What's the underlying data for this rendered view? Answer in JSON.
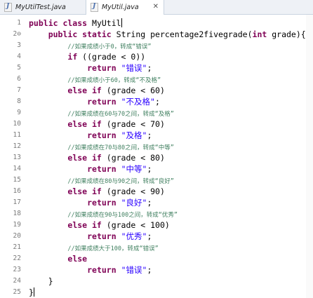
{
  "tabs": [
    {
      "label": "MyUtilTest.java",
      "active": false
    },
    {
      "label": "MyUtil.java",
      "active": true,
      "close": "✕"
    }
  ],
  "icons": {
    "java_file": "java-file-icon",
    "close": "close-icon",
    "fold": "fold-collapse-icon"
  },
  "colors": {
    "keyword": "#7f0055",
    "string": "#2a00ff",
    "comment": "#3f7f5f",
    "line_number": "#7b7b7b"
  },
  "editor": {
    "lines": [
      {
        "num": "1",
        "tokens": [
          {
            "t": "kw",
            "v": "public class"
          },
          {
            "t": "plain",
            "v": " MyUtil"
          },
          {
            "t": "cursor",
            "v": ""
          }
        ]
      },
      {
        "num": "2⊖",
        "tokens": [
          {
            "t": "plain",
            "v": "    "
          },
          {
            "t": "kw",
            "v": "public static"
          },
          {
            "t": "plain",
            "v": " String percentage2fivegrade("
          },
          {
            "t": "kw",
            "v": "int"
          },
          {
            "t": "plain",
            "v": " grade){"
          }
        ]
      },
      {
        "num": "3",
        "tokens": [
          {
            "t": "plain",
            "v": "        "
          },
          {
            "t": "cmt",
            "v": "//如果成绩小于0，转成“错误”"
          }
        ]
      },
      {
        "num": "4",
        "tokens": [
          {
            "t": "plain",
            "v": "        "
          },
          {
            "t": "kw",
            "v": "if"
          },
          {
            "t": "plain",
            "v": " ((grade < 0))"
          }
        ]
      },
      {
        "num": "5",
        "tokens": [
          {
            "t": "plain",
            "v": "            "
          },
          {
            "t": "kw",
            "v": "return"
          },
          {
            "t": "plain",
            "v": " "
          },
          {
            "t": "str",
            "v": "\"错误\""
          },
          {
            "t": "plain",
            "v": ";"
          }
        ]
      },
      {
        "num": "6",
        "tokens": [
          {
            "t": "plain",
            "v": "        "
          },
          {
            "t": "cmt",
            "v": "//如果成绩小于60，转成“不及格”"
          }
        ]
      },
      {
        "num": "7",
        "tokens": [
          {
            "t": "plain",
            "v": "        "
          },
          {
            "t": "kw",
            "v": "else if"
          },
          {
            "t": "plain",
            "v": " (grade < 60)"
          }
        ]
      },
      {
        "num": "8",
        "tokens": [
          {
            "t": "plain",
            "v": "            "
          },
          {
            "t": "kw",
            "v": "return"
          },
          {
            "t": "plain",
            "v": " "
          },
          {
            "t": "str",
            "v": "\"不及格\""
          },
          {
            "t": "plain",
            "v": ";"
          }
        ]
      },
      {
        "num": "9",
        "tokens": [
          {
            "t": "plain",
            "v": "        "
          },
          {
            "t": "cmt",
            "v": "//如果成绩在60与70之间，转成“及格”"
          }
        ]
      },
      {
        "num": "10",
        "tokens": [
          {
            "t": "plain",
            "v": "        "
          },
          {
            "t": "kw",
            "v": "else if"
          },
          {
            "t": "plain",
            "v": " (grade < 70)"
          }
        ]
      },
      {
        "num": "11",
        "tokens": [
          {
            "t": "plain",
            "v": "            "
          },
          {
            "t": "kw",
            "v": "return"
          },
          {
            "t": "plain",
            "v": " "
          },
          {
            "t": "str",
            "v": "\"及格\""
          },
          {
            "t": "plain",
            "v": ";"
          }
        ]
      },
      {
        "num": "12",
        "tokens": [
          {
            "t": "plain",
            "v": "        "
          },
          {
            "t": "cmt",
            "v": "//如果成绩在70与80之间，转成“中等”"
          }
        ]
      },
      {
        "num": "13",
        "tokens": [
          {
            "t": "plain",
            "v": "        "
          },
          {
            "t": "kw",
            "v": "else if"
          },
          {
            "t": "plain",
            "v": " (grade < 80)"
          }
        ]
      },
      {
        "num": "14",
        "tokens": [
          {
            "t": "plain",
            "v": "            "
          },
          {
            "t": "kw",
            "v": "return"
          },
          {
            "t": "plain",
            "v": " "
          },
          {
            "t": "str",
            "v": "\"中等\""
          },
          {
            "t": "plain",
            "v": ";"
          }
        ]
      },
      {
        "num": "15",
        "tokens": [
          {
            "t": "plain",
            "v": "        "
          },
          {
            "t": "cmt",
            "v": "//如果成绩在80与90之间，转成“良好”"
          }
        ]
      },
      {
        "num": "16",
        "tokens": [
          {
            "t": "plain",
            "v": "        "
          },
          {
            "t": "kw",
            "v": "else if"
          },
          {
            "t": "plain",
            "v": " (grade < 90)"
          }
        ]
      },
      {
        "num": "17",
        "tokens": [
          {
            "t": "plain",
            "v": "            "
          },
          {
            "t": "kw",
            "v": "return"
          },
          {
            "t": "plain",
            "v": " "
          },
          {
            "t": "str",
            "v": "\"良好\""
          },
          {
            "t": "plain",
            "v": ";"
          }
        ]
      },
      {
        "num": "18",
        "tokens": [
          {
            "t": "plain",
            "v": "        "
          },
          {
            "t": "cmt",
            "v": "//如果成绩在90与100之间，转成“优秀”"
          }
        ]
      },
      {
        "num": "19",
        "tokens": [
          {
            "t": "plain",
            "v": "        "
          },
          {
            "t": "kw",
            "v": "else if"
          },
          {
            "t": "plain",
            "v": " (grade < 100)"
          }
        ]
      },
      {
        "num": "20",
        "tokens": [
          {
            "t": "plain",
            "v": "            "
          },
          {
            "t": "kw",
            "v": "return"
          },
          {
            "t": "plain",
            "v": " "
          },
          {
            "t": "str",
            "v": "\"优秀\""
          },
          {
            "t": "plain",
            "v": ";"
          }
        ]
      },
      {
        "num": "21",
        "tokens": [
          {
            "t": "plain",
            "v": "        "
          },
          {
            "t": "cmt",
            "v": "//如果成绩大于100，转成“错误”"
          }
        ]
      },
      {
        "num": "22",
        "tokens": [
          {
            "t": "plain",
            "v": "        "
          },
          {
            "t": "kw",
            "v": "else"
          }
        ]
      },
      {
        "num": "23",
        "tokens": [
          {
            "t": "plain",
            "v": "            "
          },
          {
            "t": "kw",
            "v": "return"
          },
          {
            "t": "plain",
            "v": " "
          },
          {
            "t": "str",
            "v": "\"错误\""
          },
          {
            "t": "plain",
            "v": ";"
          }
        ]
      },
      {
        "num": "24",
        "tokens": [
          {
            "t": "plain",
            "v": "    }"
          }
        ]
      },
      {
        "num": "25",
        "tokens": [
          {
            "t": "plain",
            "v": "}"
          },
          {
            "t": "cursor",
            "v": ""
          }
        ]
      }
    ]
  }
}
